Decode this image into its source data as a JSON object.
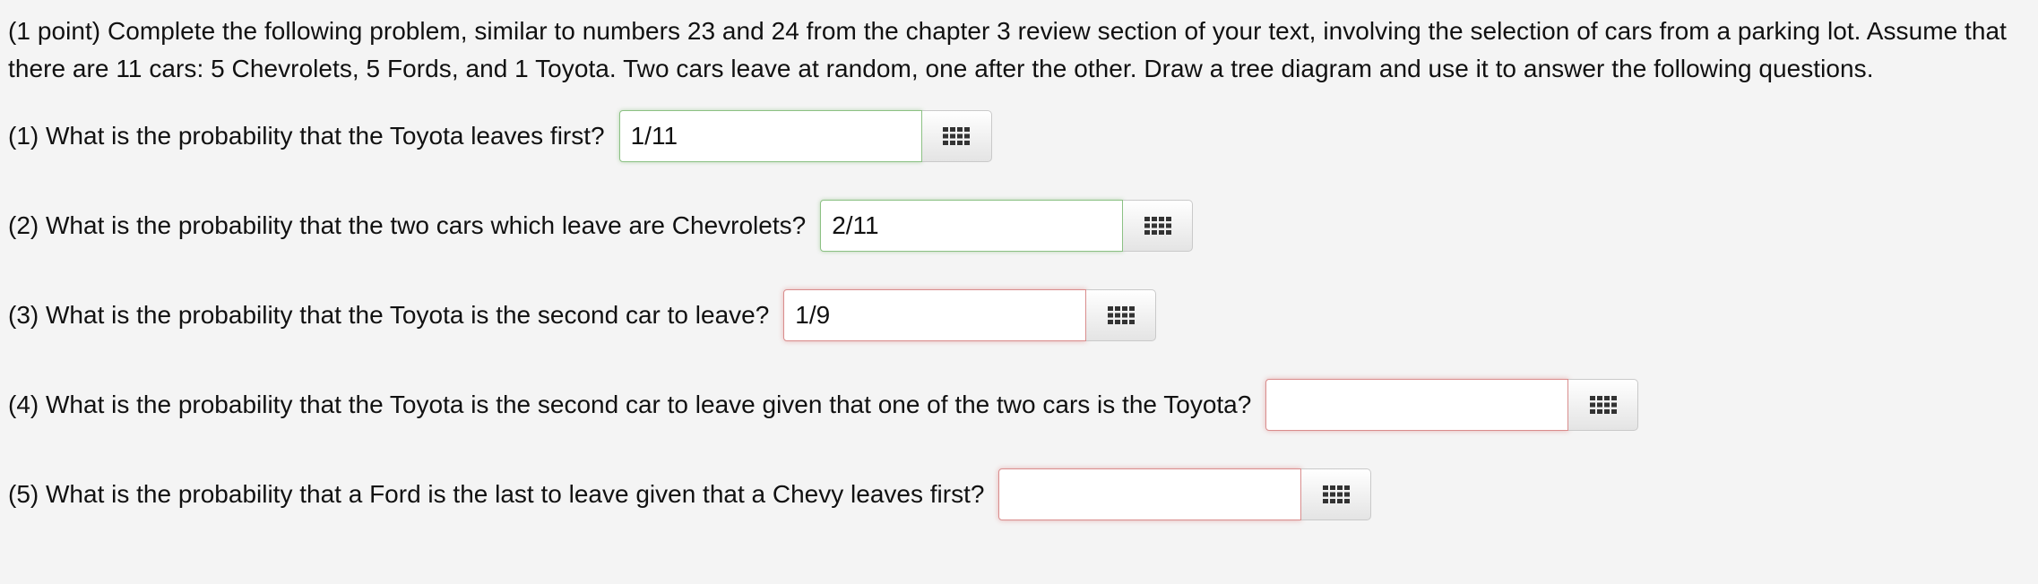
{
  "problem": {
    "intro": "(1 point) Complete the following problem, similar to numbers 23 and 24 from the chapter 3 review section of your text, involving the selection of cars from a parking lot. Assume that there are 11 cars: 5 Chevrolets, 5 Fords, and 1 Toyota. Two cars leave at random, one after the other. Draw a tree diagram and use it to answer the following questions."
  },
  "questions": [
    {
      "prompt": "(1) What is the probability that the Toyota leaves first?",
      "answer": "1/11",
      "status": "correct"
    },
    {
      "prompt": "(2) What is the probability that the two cars which leave are Chevrolets?",
      "answer": "2/11",
      "status": "correct"
    },
    {
      "prompt": "(3) What is the probability that the Toyota is the second car to leave?",
      "answer": "1/9",
      "status": "incorrect"
    },
    {
      "prompt": "(4) What is the probability that the Toyota is the second car to leave given that one of the two cars is the Toyota?",
      "answer": "",
      "status": "incorrect"
    },
    {
      "prompt": "(5) What is the probability that a Ford is the last to leave given that a Chevy leaves first?",
      "answer": "",
      "status": "incorrect"
    }
  ],
  "icons": {
    "palette_button": "equation-editor-grid-icon"
  },
  "colors": {
    "background": "#f4f4f4",
    "correct_border": "#8cc184",
    "incorrect_border": "#d98d8d"
  }
}
